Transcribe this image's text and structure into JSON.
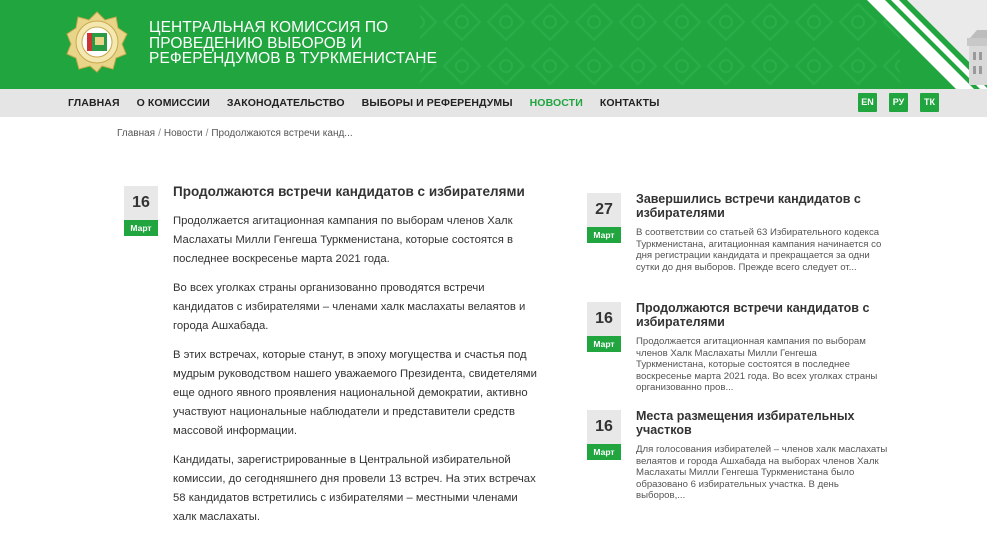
{
  "header": {
    "title_lines": [
      "ЦЕНТРАЛЬНАЯ КОМИССИЯ ПО",
      "ПРОВЕДЕНИЮ ВЫБОРОВ И",
      "РЕФЕРЕНДУМОВ В ТУРКМЕНИСТАНЕ"
    ],
    "emblem_icon": "commission-emblem-icon",
    "brand_color": "#20a53f"
  },
  "nav": {
    "items": [
      {
        "label": "ГЛАВНАЯ",
        "active": false
      },
      {
        "label": "О КОМИССИИ",
        "active": false
      },
      {
        "label": "ЗАКОНОДАТЕЛЬСТВО",
        "active": false
      },
      {
        "label": "ВЫБОРЫ И РЕФЕРЕНДУМЫ",
        "active": false
      },
      {
        "label": "НОВОСТИ",
        "active": true
      },
      {
        "label": "КОНТАКТЫ",
        "active": false
      }
    ],
    "languages": [
      "EN",
      "РУ",
      "ТК"
    ]
  },
  "breadcrumb": {
    "items": [
      "Главная",
      "Новости",
      "Продолжаются встречи канд..."
    ],
    "separator": "/"
  },
  "article": {
    "day": "16",
    "month": "Март",
    "title": "Продолжаются встречи кандидатов с избирателями",
    "paragraphs": [
      "Продолжается агитационная кампания по выборам членов Халк Маслахаты Милли Генгеша Туркменистана, которые состоятся в последнее воскресенье марта 2021 года.",
      "Во всех уголках страны организованно проводятся встречи кандидатов с избирателями – членами халк маслахаты велаятов и города Ашхабада.",
      "В этих встречах, которые станут, в эпоху могущества и счастья под мудрым руководством нашего уважаемого Президента, свидетелями еще одного явного проявления национальной демократии, активно участвуют национальные наблюдатели и представители средств массовой информации.",
      "Кандидаты, зарегистрированные в Центральной избирательной комиссии, до сегодняшнего дня провели 13 встреч. На этих встречах 58 кандидатов встретились с избирателями – местными членами халк маслахаты."
    ]
  },
  "sidebar": {
    "items": [
      {
        "day": "27",
        "month": "Март",
        "title": "Завершились встречи кандидатов с избирателями",
        "excerpt": "В соответствии со статьей 63 Избирательного кодекса Туркменистана, агитационная кампания начинается со дня регистрации кандидата и прекращается за одни сутки до дня выборов. Прежде всего следует от..."
      },
      {
        "day": "16",
        "month": "Март",
        "title": "Продолжаются встречи кандидатов с избирателями",
        "excerpt": "Продолжается агитационная кампания по выборам членов Халк Маслахаты Милли Генгеша Туркменистана, которые состоятся в последнее воскресенье марта 2021 года. Во всех уголках страны организованно пров..."
      },
      {
        "day": "16",
        "month": "Март",
        "title": "Места размещения избирательных участков",
        "excerpt": "Для голосования избирателей – членов халк маслахаты велаятов и города Ашхабада на выборах членов Халк Маслахаты Милли Генгеша Туркменистана было образовано 6 избирательных участка. В день выборов,..."
      }
    ]
  }
}
